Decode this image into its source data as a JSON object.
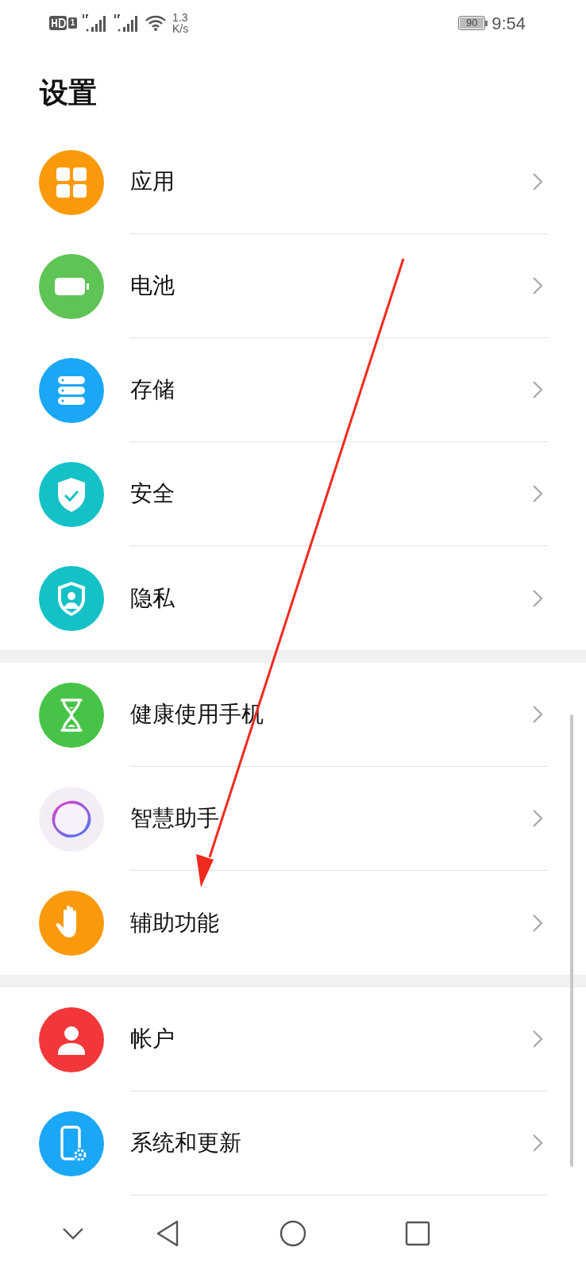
{
  "status_bar": {
    "sim_badge": "1",
    "speed_value": "1.3",
    "speed_unit": "K/s",
    "battery": "90",
    "time": "9:54"
  },
  "title": "设置",
  "groups": [
    {
      "items": [
        {
          "label": "应用",
          "kind": "apps",
          "color": "#fa9a0a"
        },
        {
          "label": "电池",
          "kind": "battery",
          "color": "#5fc456"
        },
        {
          "label": "存储",
          "kind": "storage",
          "color": "#1aa7f5"
        },
        {
          "label": "安全",
          "kind": "shield",
          "color": "#14c1c6"
        },
        {
          "label": "隐私",
          "kind": "privacy",
          "color": "#14c1c6"
        }
      ]
    },
    {
      "items": [
        {
          "label": "健康使用手机",
          "kind": "hourglass",
          "color": "#47c447"
        },
        {
          "label": "智慧助手",
          "kind": "assistant",
          "color": "#f3eef6"
        },
        {
          "label": "辅助功能",
          "kind": "hand",
          "color": "#fa9a0a"
        }
      ]
    },
    {
      "items": [
        {
          "label": "帐户",
          "kind": "account",
          "color": "#f2373a"
        },
        {
          "label": "系统和更新",
          "kind": "system",
          "color": "#1aa7f5"
        }
      ]
    }
  ],
  "annotation": {
    "kind": "arrow",
    "color": "#f02a1e"
  }
}
